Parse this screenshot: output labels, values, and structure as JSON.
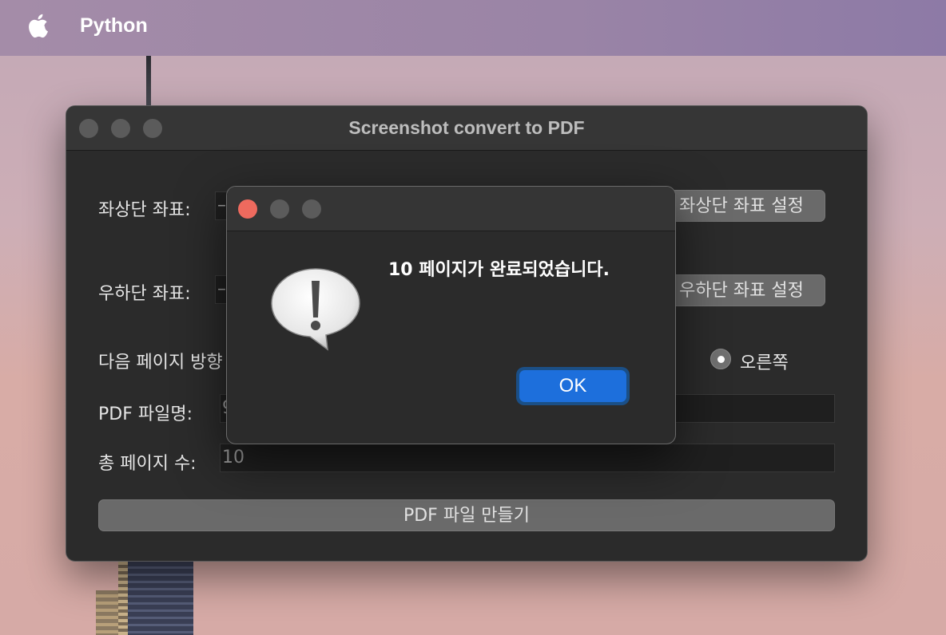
{
  "menubar": {
    "apple_icon": "apple-logo-icon",
    "app_name": "Python"
  },
  "window": {
    "title": "Screenshot convert to PDF",
    "top_left_label": "좌상단 좌표:",
    "top_left_value": "–",
    "top_left_button": "좌상단 좌표 설정",
    "bottom_right_label": "우하단 좌표:",
    "bottom_right_value": "–",
    "bottom_right_button": "우하단 좌표 설정",
    "direction_label": "다음 페이지 방향",
    "direction_right_option": "오른쪽",
    "pdf_name_label": "PDF 파일명:",
    "pdf_name_value": "9",
    "page_count_label": "총 페이지 수:",
    "page_count_value": "10",
    "make_pdf_button": "PDF 파일 만들기"
  },
  "alert": {
    "icon": "warning-speech-bubble-icon",
    "message": "10 페이지가 완료되었습니다.",
    "ok_label": "OK",
    "accent_color": "#1d6fdc",
    "close_color": "#ee6a5e"
  }
}
